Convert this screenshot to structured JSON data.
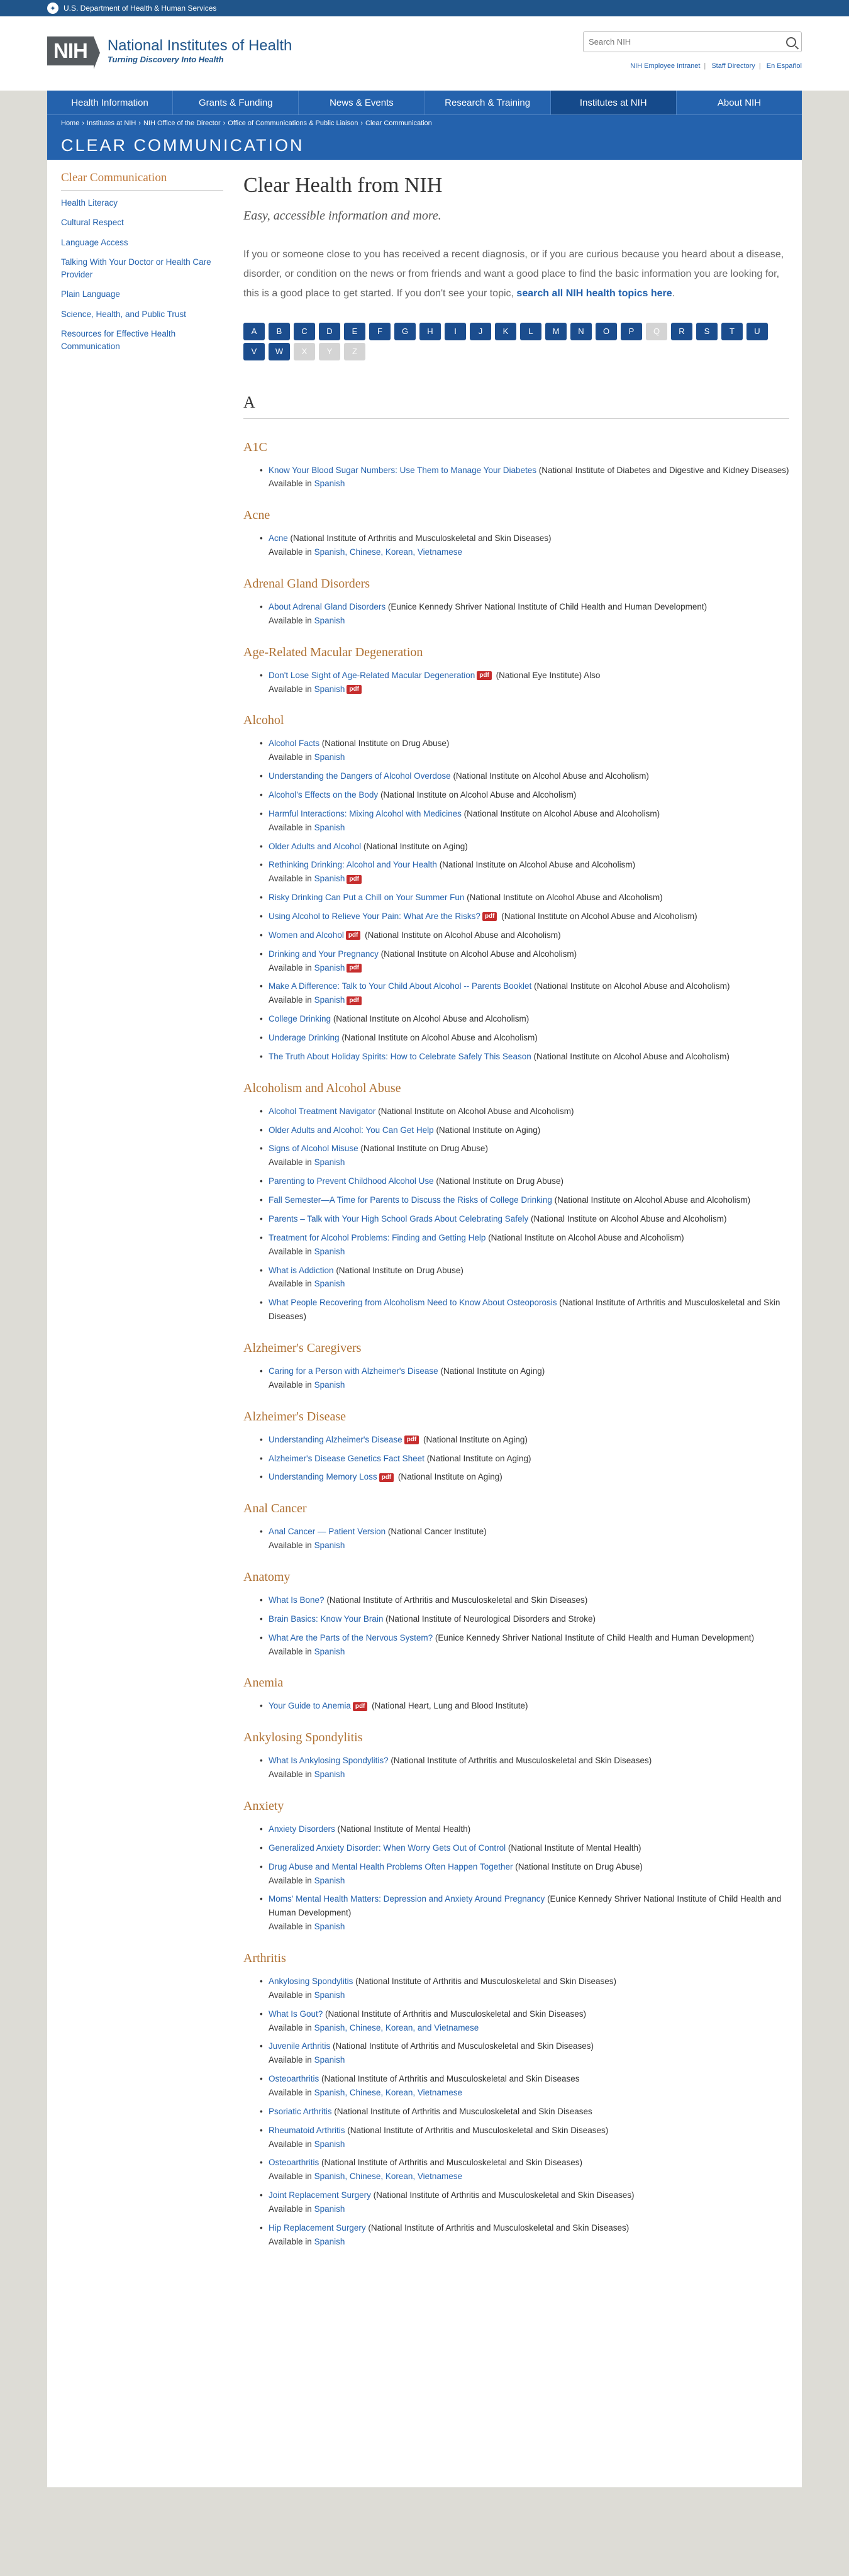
{
  "hhs": "U.S. Department of Health & Human Services",
  "logo": {
    "abbr": "NIH",
    "title": "National Institutes of Health",
    "tagline": "Turning Discovery Into Health"
  },
  "search": {
    "placeholder": "Search NIH"
  },
  "util_links": [
    "NIH Employee Intranet",
    "Staff Directory",
    "En Español"
  ],
  "nav": [
    "Health Information",
    "Grants & Funding",
    "News & Events",
    "Research & Training",
    "Institutes at NIH",
    "About NIH"
  ],
  "breadcrumb": [
    "Home",
    "Institutes at NIH",
    "NIH Office of the Director",
    "Office of Communications & Public Liaison",
    "Clear Communication"
  ],
  "banner": "CLEAR COMMUNICATION",
  "sidebar": {
    "title": "Clear Communication",
    "items": [
      "Health Literacy",
      "Cultural Respect",
      "Language Access",
      "Talking With Your Doctor or Health Care Provider",
      "Plain Language",
      "Science, Health, and Public Trust",
      "Resources for Effective Health Communication"
    ]
  },
  "page": {
    "title": "Clear Health from NIH",
    "subtitle": "Easy, accessible information and more.",
    "intro": "If you or someone close to you has received a recent diagnosis, or if you are curious because you heard about a disease, disorder, or condition on the news or from friends and want a good place to find the basic information you are looking for, this is a good place to get started. If you don't see your topic, ",
    "intro_link": "search all NIH health topics here",
    "intro_end": "."
  },
  "alphabet": [
    {
      "l": "A",
      "on": true
    },
    {
      "l": "B",
      "on": true
    },
    {
      "l": "C",
      "on": true
    },
    {
      "l": "D",
      "on": true
    },
    {
      "l": "E",
      "on": true
    },
    {
      "l": "F",
      "on": true
    },
    {
      "l": "G",
      "on": true
    },
    {
      "l": "H",
      "on": true
    },
    {
      "l": "I",
      "on": true
    },
    {
      "l": "J",
      "on": true
    },
    {
      "l": "K",
      "on": true
    },
    {
      "l": "L",
      "on": true
    },
    {
      "l": "M",
      "on": true
    },
    {
      "l": "N",
      "on": true
    },
    {
      "l": "O",
      "on": true
    },
    {
      "l": "P",
      "on": true
    },
    {
      "l": "Q",
      "on": false
    },
    {
      "l": "R",
      "on": true
    },
    {
      "l": "S",
      "on": true
    },
    {
      "l": "T",
      "on": true
    },
    {
      "l": "U",
      "on": true
    },
    {
      "l": "V",
      "on": true
    },
    {
      "l": "W",
      "on": true
    },
    {
      "l": "X",
      "on": false
    },
    {
      "l": "Y",
      "on": false
    },
    {
      "l": "Z",
      "on": false
    }
  ],
  "letter": "A",
  "topics": [
    {
      "name": "A1C",
      "items": [
        {
          "link": "Know Your Blood Sugar Numbers: Use Them to Manage Your Diabetes",
          "src": " (National Institute of Diabetes and Digestive and Kidney Diseases)",
          "avail": [
            "Spanish"
          ]
        }
      ]
    },
    {
      "name": "Acne",
      "items": [
        {
          "link": "Acne",
          "src": " (National Institute of Arthritis and Musculoskeletal and Skin Diseases)",
          "avail": [
            "Spanish, Chinese, Korean, Vietnamese"
          ]
        }
      ]
    },
    {
      "name": "Adrenal Gland Disorders",
      "items": [
        {
          "link": "About Adrenal Gland Disorders",
          "src": " (Eunice Kennedy Shriver National Institute of Child Health and Human Development)",
          "avail": [
            "Spanish"
          ]
        }
      ]
    },
    {
      "name": "Age-Related Macular Degeneration",
      "items": [
        {
          "link": "Don't Lose Sight of Age-Related Macular Degeneration",
          "pdf": true,
          "src": " (National Eye Institute) Also",
          "avail": [
            "Spanish"
          ],
          "avail_pdf": true
        }
      ]
    },
    {
      "name": "Alcohol",
      "items": [
        {
          "link": "Alcohol Facts",
          "src": " (National Institute on Drug Abuse)",
          "avail": [
            "Spanish"
          ]
        },
        {
          "link": "Understanding the Dangers of Alcohol Overdose",
          "src": " (National Institute on Alcohol Abuse and Alcoholism)"
        },
        {
          "link": "Alcohol's Effects on the Body",
          "src": " (National Institute on Alcohol Abuse and Alcoholism)"
        },
        {
          "link": "Harmful Interactions: Mixing Alcohol with Medicines",
          "src": " (National Institute on Alcohol Abuse and Alcoholism)",
          "avail": [
            "Spanish"
          ]
        },
        {
          "link": "Older Adults and Alcohol",
          "src": " (National Institute on Aging)"
        },
        {
          "link": "Rethinking Drinking: Alcohol and Your Health",
          "src": " (National Institute on Alcohol Abuse and Alcoholism)",
          "avail": [
            "Spanish"
          ],
          "avail_pdf": true
        },
        {
          "link": "Risky Drinking Can Put a Chill on Your Summer Fun",
          "src": " (National Institute on Alcohol Abuse and Alcoholism)"
        },
        {
          "link": "Using Alcohol to Relieve Your Pain: What Are the Risks?",
          "pdf": true,
          "src": " (National Institute on Alcohol Abuse and Alcoholism)"
        },
        {
          "link": "Women and Alcohol",
          "pdf": true,
          "src": " (National Institute on Alcohol Abuse and Alcoholism)"
        },
        {
          "link": "Drinking and Your Pregnancy",
          "src": " (National Institute on Alcohol Abuse and Alcoholism)",
          "avail": [
            "Spanish"
          ],
          "avail_pdf": true
        },
        {
          "link": "Make A Difference: Talk to Your Child About Alcohol -- Parents Booklet",
          "src": " (National Institute on Alcohol Abuse and Alcoholism)",
          "avail": [
            "Spanish"
          ],
          "avail_pdf": true
        },
        {
          "link": "College Drinking",
          "src": " (National Institute on Alcohol Abuse and Alcoholism)"
        },
        {
          "link": "Underage Drinking",
          "src": " (National Institute on Alcohol Abuse and Alcoholism)"
        },
        {
          "link": "The Truth About Holiday Spirits: How to Celebrate Safely This Season",
          "src": " (National Institute on Alcohol Abuse and Alcoholism)"
        }
      ]
    },
    {
      "name": "Alcoholism and Alcohol Abuse",
      "items": [
        {
          "link": "Alcohol Treatment Navigator",
          "src": " (National Institute on Alcohol Abuse and Alcoholism)"
        },
        {
          "link": "Older Adults and Alcohol: You Can Get Help",
          "src": " (National Institute on Aging)"
        },
        {
          "link": "Signs of Alcohol Misuse",
          "src": " (National Institute on Drug Abuse)",
          "avail": [
            "Spanish"
          ]
        },
        {
          "link": "Parenting to Prevent Childhood Alcohol Use",
          "src": " (National Institute on Drug Abuse)"
        },
        {
          "link": "Fall Semester—A Time for Parents to Discuss the Risks of College Drinking",
          "src": " (National Institute on Alcohol Abuse and Alcoholism)"
        },
        {
          "link": "Parents – Talk with Your High School Grads About Celebrating Safely",
          "src": " (National Institute on Alcohol Abuse and Alcoholism)"
        },
        {
          "link": "Treatment for Alcohol Problems: Finding and Getting Help",
          "src": " (National Institute on Alcohol Abuse and Alcoholism)",
          "avail": [
            "Spanish"
          ]
        },
        {
          "link": "What is Addiction",
          "src": " (National Institute on Drug Abuse)",
          "avail": [
            "Spanish"
          ]
        },
        {
          "link": "What People Recovering from Alcoholism Need to Know About Osteoporosis",
          "src": " (National Institute of Arthritis and Musculoskeletal and Skin Diseases)"
        }
      ]
    },
    {
      "name": "Alzheimer's Caregivers",
      "items": [
        {
          "link": "Caring for a Person with Alzheimer's Disease",
          "src": " (National Institute on Aging)",
          "avail": [
            "Spanish"
          ]
        }
      ]
    },
    {
      "name": "Alzheimer's Disease",
      "items": [
        {
          "link": "Understanding Alzheimer's Disease",
          "pdf": true,
          "src": " (National Institute on Aging)"
        },
        {
          "link": "Alzheimer's Disease Genetics Fact Sheet",
          "src": " (National Institute on Aging)"
        },
        {
          "link": "Understanding Memory Loss",
          "pdf": true,
          "src": " (National Institute on Aging)"
        }
      ]
    },
    {
      "name": "Anal Cancer",
      "items": [
        {
          "link": "Anal Cancer — Patient Version",
          "src": " (National Cancer Institute)",
          "avail": [
            "Spanish"
          ]
        }
      ]
    },
    {
      "name": "Anatomy",
      "items": [
        {
          "link": "What Is Bone?",
          "src": " (National Institute of Arthritis and Musculoskeletal and Skin Diseases)"
        },
        {
          "link": "Brain Basics: Know Your Brain",
          "src": " (National Institute of Neurological Disorders and Stroke)"
        },
        {
          "link": "What Are the Parts of the Nervous System?",
          "src": " (Eunice Kennedy Shriver National Institute of Child Health and Human Development)",
          "avail": [
            "Spanish"
          ]
        }
      ]
    },
    {
      "name": "Anemia",
      "items": [
        {
          "link": "Your Guide to Anemia",
          "pdf": true,
          "src": " (National Heart, Lung and Blood Institute)"
        }
      ]
    },
    {
      "name": "Ankylosing Spondylitis",
      "items": [
        {
          "link": "What Is Ankylosing Spondylitis?",
          "src": " (National Institute of Arthritis and Musculoskeletal and Skin Diseases)",
          "avail": [
            "Spanish"
          ]
        }
      ]
    },
    {
      "name": "Anxiety",
      "items": [
        {
          "link": "Anxiety Disorders",
          "src": " (National Institute of Mental Health)"
        },
        {
          "link": "Generalized Anxiety Disorder: When Worry Gets Out of Control",
          "src": " (National Institute of Mental Health)"
        },
        {
          "link": "Drug Abuse and Mental Health Problems Often Happen Together",
          "src": " (National Institute on Drug Abuse)",
          "avail": [
            "Spanish"
          ]
        },
        {
          "link": "Moms' Mental Health Matters: Depression and Anxiety Around Pregnancy",
          "src": " (Eunice Kennedy Shriver National Institute of Child Health and Human Development)",
          "avail": [
            "Spanish"
          ]
        }
      ]
    },
    {
      "name": "Arthritis",
      "items": [
        {
          "link": "Ankylosing Spondylitis",
          "src": " (National Institute of Arthritis and Musculoskeletal and Skin Diseases)",
          "avail": [
            "Spanish"
          ]
        },
        {
          "link": "What Is Gout?",
          "src": " (National Institute of Arthritis and Musculoskeletal and Skin Diseases)",
          "avail": [
            "Spanish, Chinese, Korean, and Vietnamese"
          ]
        },
        {
          "link": "Juvenile Arthritis",
          "src": " (National Institute of Arthritis and Musculoskeletal and Skin Diseases)",
          "avail": [
            "Spanish"
          ]
        },
        {
          "link": "Osteoarthritis",
          "src": " (National Institute of Arthritis and Musculoskeletal and Skin Diseases",
          "avail": [
            "Spanish, Chinese, Korean, Vietnamese"
          ]
        },
        {
          "link": "Psoriatic Arthritis",
          "src": " (National Institute of Arthritis and Musculoskeletal and Skin Diseases"
        },
        {
          "link": "Rheumatoid Arthritis",
          "src": " (National Institute of Arthritis and Musculoskeletal and Skin Diseases)",
          "avail": [
            "Spanish"
          ]
        },
        {
          "link": "Osteoarthritis",
          "src": " (National Institute of Arthritis and Musculoskeletal and Skin Diseases)",
          "avail": [
            "Spanish, Chinese, Korean, Vietnamese"
          ]
        },
        {
          "link": "Joint Replacement Surgery",
          "src": " (National Institute of Arthritis and Musculoskeletal and Skin Diseases)",
          "avail": [
            "Spanish"
          ]
        },
        {
          "link": "Hip Replacement Surgery",
          "src": " (National Institute of Arthritis and Musculoskeletal and Skin Diseases)",
          "avail": [
            "Spanish"
          ]
        }
      ]
    }
  ],
  "labels": {
    "available": "Available in ",
    "pdf": "pdf"
  }
}
